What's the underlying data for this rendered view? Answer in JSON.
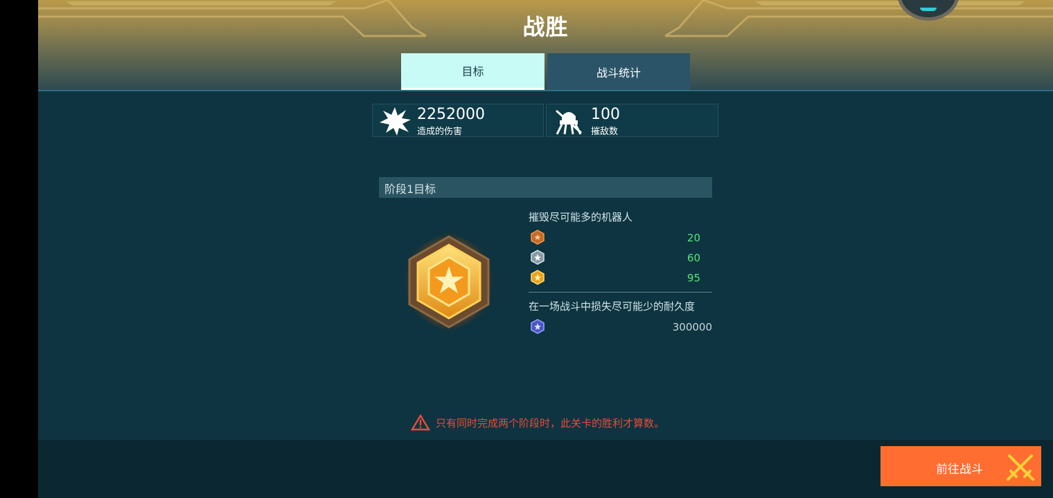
{
  "header": {
    "title": "战胜"
  },
  "tabs": {
    "goals": "目标",
    "stats": "战斗统计"
  },
  "stats": {
    "damage_value": "2252000",
    "damage_label": "造成的伤害",
    "kills_value": "100",
    "kills_label": "摧敌数"
  },
  "stage": {
    "title": "阶段1目标",
    "goal1": {
      "title": "摧毁尽可能多的机器人",
      "tiers": [
        {
          "icon": "bronze-medal-icon",
          "value": "20"
        },
        {
          "icon": "silver-medal-icon",
          "value": "60"
        },
        {
          "icon": "gold-medal-icon",
          "value": "95"
        }
      ]
    },
    "goal2": {
      "title": "在一场战斗中损失尽可能少的耐久度",
      "icon": "platinum-medal-icon",
      "value": "300000"
    }
  },
  "warning": "只有同时完成两个阶段时，此关卡的胜利才算数。",
  "go_button": "前往战斗",
  "colors": {
    "accent_tab": "#c8fbf5",
    "tier_value": "#52e878",
    "warning": "#e84b3c",
    "go_button": "#ff6e30"
  }
}
